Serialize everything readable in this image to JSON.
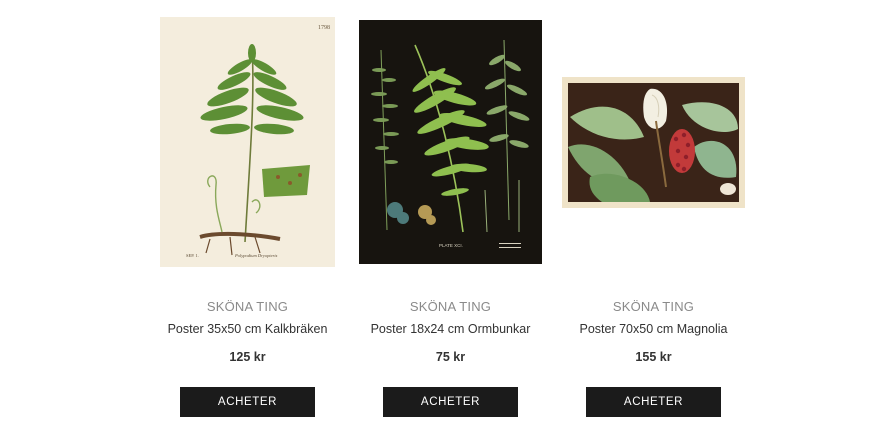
{
  "products": [
    {
      "brand": "SKÖNA TING",
      "title": "Poster 35x50 cm Kalkbräken",
      "price": "125 kr",
      "button": "ACHETER"
    },
    {
      "brand": "SKÖNA TING",
      "title": "Poster 18x24 cm Ormbunkar",
      "price": "75 kr",
      "button": "ACHETER"
    },
    {
      "brand": "SKÖNA TING",
      "title": "Poster 70x50 cm Magnolia",
      "price": "155 kr",
      "button": "ACHETER"
    }
  ],
  "colors": {
    "button_bg": "#1b1b1b",
    "button_text": "#ffffff",
    "brand_text": "#8a8a8a",
    "body_text": "#333333"
  }
}
